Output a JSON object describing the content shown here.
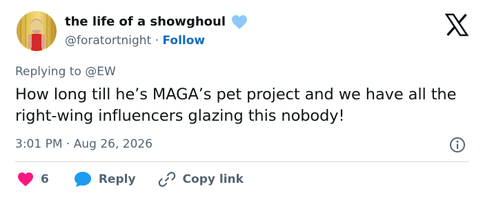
{
  "author": {
    "display_name": "the life of a showghoul",
    "handle": "@foratortnight",
    "separator": "·",
    "follow_label": "Follow"
  },
  "tweet": {
    "replying_to": "Replying to @EW",
    "text": "How long till he’s MAGA’s pet project and we have all the right-wing influencers glazing this nobody!",
    "time": "3:01 PM",
    "date_separator": "·",
    "date": "Aug 26, 2026"
  },
  "actions": {
    "like_count": "6",
    "reply_label": "Reply",
    "copy_link_label": "Copy link"
  },
  "icons": {
    "verified": "heart-badge-icon",
    "brand": "x-logo-icon",
    "info": "info-icon",
    "like": "heart-icon",
    "reply": "speech-bubble-icon",
    "copy": "link-icon"
  },
  "colors": {
    "text": "#0f1419",
    "secondary": "#536471",
    "link": "#0f6bc4",
    "like_heart": "#f91880",
    "reply_bubble": "#1d9bf0",
    "badge_heart": "#8ec8f8",
    "divider": "#cfd9de"
  }
}
